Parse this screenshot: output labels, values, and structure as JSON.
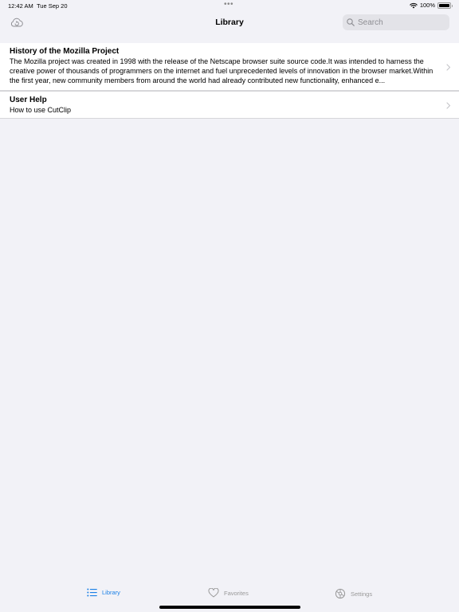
{
  "status_bar": {
    "time": "12:42 AM",
    "date": "Tue Sep 20",
    "dots": "•••",
    "battery": "100%"
  },
  "nav": {
    "title": "Library",
    "search_placeholder": "Search"
  },
  "items": [
    {
      "title": "History of the Mozilla Project",
      "description": "The Mozilla project was created in 1998 with the release of the Netscape browser suite source code.It was intended to harness the creative power of thousands of programmers on the internet and fuel unprecedented levels of innovation in the browser market.Within the first year, new community members from around the world had already contributed new functionality, enhanced e..."
    },
    {
      "title": "User Help",
      "description": "How to use CutClip"
    }
  ],
  "tabs": [
    {
      "label": "Library",
      "active": true
    },
    {
      "label": "Favorites",
      "active": false
    },
    {
      "label": "Settings",
      "active": false
    }
  ],
  "colors": {
    "accent": "#1b80e6",
    "background": "#f2f2f7",
    "inactive": "#999999"
  }
}
